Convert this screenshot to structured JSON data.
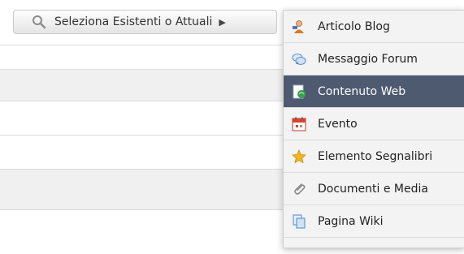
{
  "toolbar": {
    "select_label": "Seleziona Esistenti o Attuali",
    "search_icon": "search-icon",
    "arrow_icon": "right-arrow-icon"
  },
  "menu": {
    "items": [
      {
        "label": "Articolo Blog",
        "icon": "blog-icon"
      },
      {
        "label": "Messaggio Forum",
        "icon": "forum-icon"
      },
      {
        "label": "Contenuto Web",
        "icon": "web-content-icon",
        "active": true
      },
      {
        "label": "Evento",
        "icon": "calendar-icon"
      },
      {
        "label": "Elemento Segnalibri",
        "icon": "star-icon"
      },
      {
        "label": "Documenti e Media",
        "icon": "paperclip-icon"
      },
      {
        "label": "Pagina Wiki",
        "icon": "pages-icon"
      }
    ]
  },
  "colors": {
    "active_bg": "#4d5a6f",
    "menu_bg": "#f3f3f3",
    "row_grey": "#f0f0f0"
  }
}
